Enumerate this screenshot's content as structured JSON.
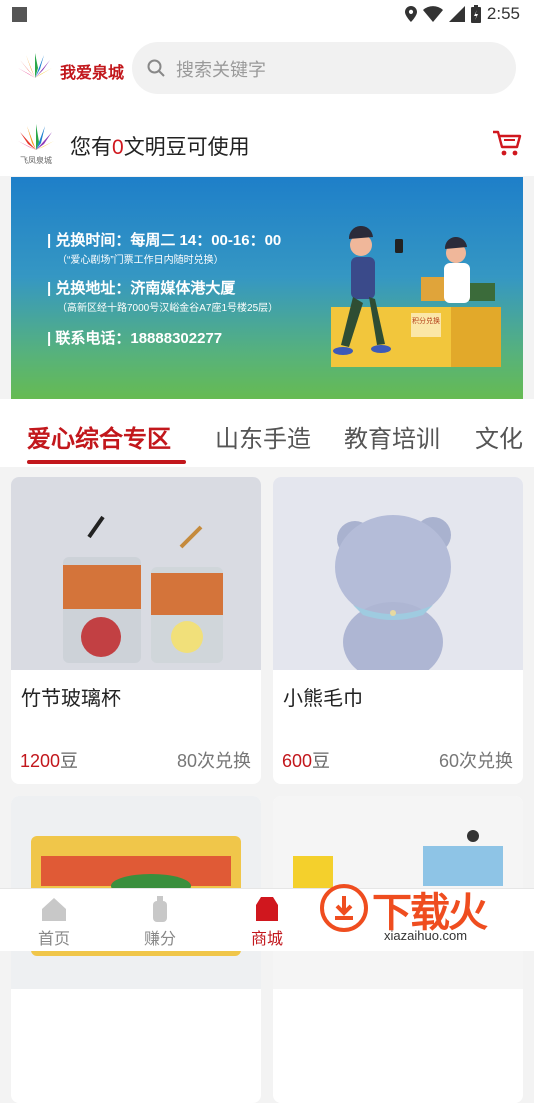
{
  "status_bar": {
    "time": "2:55"
  },
  "header": {
    "brand": "我爱泉城",
    "search_placeholder": "搜索关键字"
  },
  "beans_bar": {
    "prefix": "您有",
    "count": "0",
    "suffix": "文明豆可使用",
    "logo_caption": "飞凤泉城"
  },
  "banner": {
    "line1": "| 兑换时间：每周二 14：00-16：00",
    "line2": "（“爱心剧场”门票工作日内随时兑换）",
    "line3": "| 兑换地址：济南媒体港大厦",
    "line4": "（高新区经十路7000号汉峪金谷A7座1号楼25层）",
    "line5": "| 联系电话：18888302277",
    "sign": "积分兑换"
  },
  "tabs": [
    "爱心综合专区",
    "山东手造",
    "教育培训",
    "文化"
  ],
  "products": [
    {
      "name": "竹节玻璃杯",
      "price": "1200",
      "unit": "豆",
      "redeemed": "80次兑换"
    },
    {
      "name": "小熊毛巾",
      "price": "600",
      "unit": "豆",
      "redeemed": "60次兑换"
    }
  ],
  "bottom_nav": [
    {
      "label": "首页",
      "icon": "home-icon"
    },
    {
      "label": "赚分",
      "icon": "bottle-icon"
    },
    {
      "label": "商城",
      "icon": "shop-icon"
    }
  ],
  "watermark": {
    "title": "下载火",
    "url": "xiazaihuo.com"
  },
  "colors": {
    "accent": "#c2171c",
    "banner_top": "#1e7fc9",
    "banner_bottom": "#66bb52"
  }
}
